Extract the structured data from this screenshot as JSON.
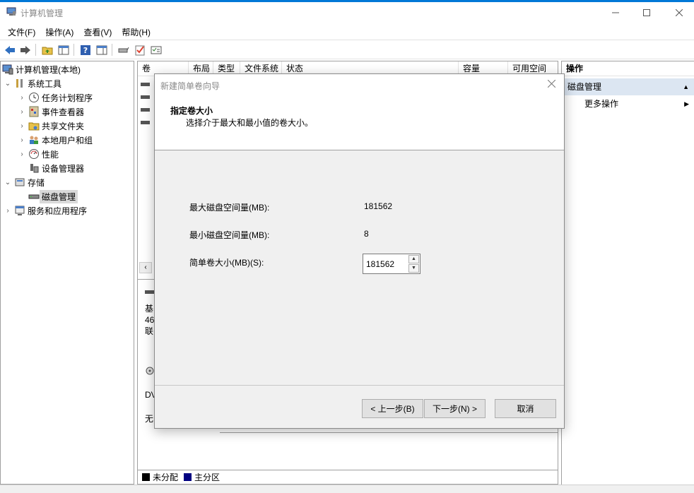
{
  "window": {
    "title": "计算机管理"
  },
  "menu": [
    "文件(F)",
    "操作(A)",
    "查看(V)",
    "帮助(H)"
  ],
  "tree": {
    "root": "计算机管理(本地)",
    "system_tools": "系统工具",
    "task_scheduler": "任务计划程序",
    "event_viewer": "事件查看器",
    "shared_folders": "共享文件夹",
    "local_users": "本地用户和组",
    "performance": "性能",
    "device_manager": "设备管理器",
    "storage": "存储",
    "disk_management": "磁盘管理",
    "services_apps": "服务和应用程序"
  },
  "volume_list": {
    "columns": [
      "卷",
      "布局",
      "类型",
      "文件系统",
      "状态",
      "容量",
      "可用空间"
    ]
  },
  "disk_area": {
    "disk0_fragment": [
      "基",
      "46",
      "联"
    ],
    "disk1_fragment": [
      "DV",
      "无"
    ]
  },
  "legend": [
    {
      "label": "未分配",
      "color": "#000000"
    },
    {
      "label": "主分区",
      "color": "#000080"
    }
  ],
  "actions": {
    "header": "操作",
    "section": "磁盘管理",
    "more": "更多操作"
  },
  "dialog": {
    "title": "新建简单卷向导",
    "heading": "指定卷大小",
    "subheading": "选择介于最大和最小值的卷大小。",
    "max_label": "最大磁盘空间量(MB):",
    "max_value": "181562",
    "min_label": "最小磁盘空间量(MB):",
    "min_value": "8",
    "size_label": "简单卷大小(MB)(S):",
    "size_value": "181562",
    "back_button": "< 上一步(B)",
    "next_button": "下一步(N) >",
    "cancel_button": "取消"
  }
}
